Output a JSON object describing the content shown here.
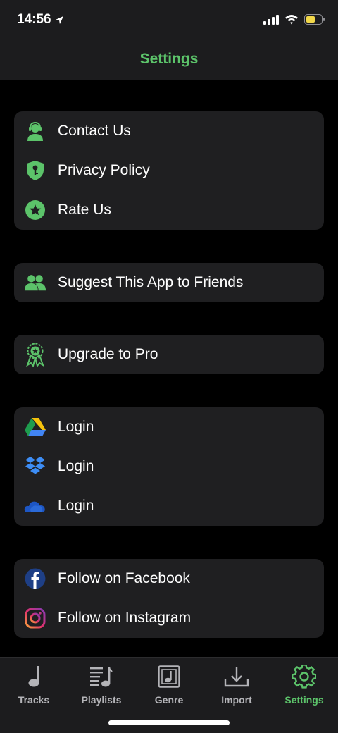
{
  "status": {
    "time": "14:56"
  },
  "header": {
    "title": "Settings"
  },
  "groups": [
    {
      "items": [
        {
          "label": "Contact Us",
          "icon": "support-agent-icon"
        },
        {
          "label": "Privacy Policy",
          "icon": "shield-key-icon"
        },
        {
          "label": "Rate Us",
          "icon": "star-circle-icon"
        }
      ]
    },
    {
      "items": [
        {
          "label": "Suggest This App to Friends",
          "icon": "people-icon"
        }
      ]
    },
    {
      "items": [
        {
          "label": "Upgrade to Pro",
          "icon": "award-badge-icon"
        }
      ]
    },
    {
      "items": [
        {
          "label": "Login",
          "icon": "google-drive-icon"
        },
        {
          "label": "Login",
          "icon": "dropbox-icon"
        },
        {
          "label": "Login",
          "icon": "onedrive-icon"
        }
      ]
    },
    {
      "items": [
        {
          "label": "Follow on Facebook",
          "icon": "facebook-icon"
        },
        {
          "label": "Follow on Instagram",
          "icon": "instagram-icon"
        }
      ]
    }
  ],
  "tabs": [
    {
      "label": "Tracks",
      "icon": "music-note-icon"
    },
    {
      "label": "Playlists",
      "icon": "playlist-icon"
    },
    {
      "label": "Genre",
      "icon": "genre-icon"
    },
    {
      "label": "Import",
      "icon": "import-icon"
    },
    {
      "label": "Settings",
      "icon": "gear-icon",
      "active": true
    }
  ],
  "colors": {
    "accent": "#5cc36a",
    "background": "#000000",
    "card": "#1f1f21",
    "bar": "#1c1c1e"
  }
}
